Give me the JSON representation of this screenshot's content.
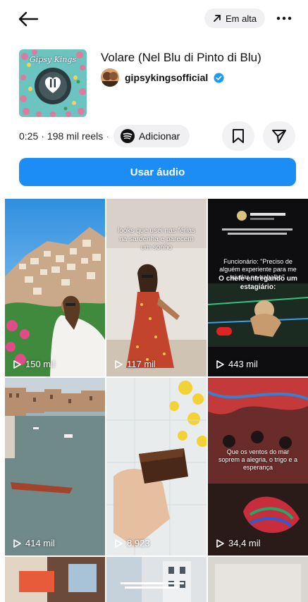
{
  "header": {
    "back_icon": "arrow-left-icon",
    "trending_label": "Em alta",
    "trending_icon": "arrow-up-right-icon",
    "more_icon": "ellipsis-icon"
  },
  "audio": {
    "title": "Volare (Nel Blu di Pinto di Blu)",
    "artist": "gipsykingsofficial",
    "cover_text": "Gipsy Kings",
    "duration": "0:25",
    "reels_count": "198 mil reels",
    "separator": "·",
    "add_label": "Adicionar",
    "use_audio_label": "Usar áudio"
  },
  "colors": {
    "accent": "#1b8df5",
    "verified": "#1d9bf0",
    "chip_bg": "#f0f0f2"
  },
  "reels": [
    {
      "views": "150 mil",
      "overlay": ""
    },
    {
      "views": "117 mil",
      "overlay": "looks que usei nas férias na sardenha e parecem um sonho"
    },
    {
      "views": "443 mil",
      "overlay_top": "Funcionário: \"Preciso de alguém experiente para me ajudar no trabalho\"",
      "overlay_bottom": "O chefe entregando um estagiário:"
    },
    {
      "views": "414 mil",
      "overlay": ""
    },
    {
      "views": "8.923",
      "overlay": ""
    },
    {
      "views": "34,4 mil",
      "overlay": "Que os ventos do mar soprem a alegria, o trigo e a esperança"
    },
    {
      "views": "",
      "overlay": ""
    },
    {
      "views": "",
      "overlay": ""
    },
    {
      "views": "",
      "overlay": ""
    }
  ]
}
